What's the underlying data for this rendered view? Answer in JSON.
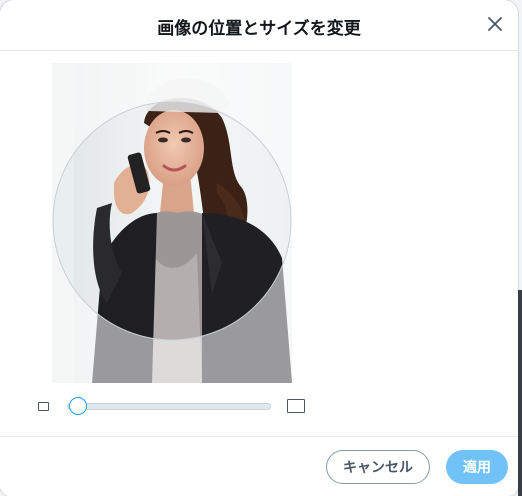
{
  "dialog": {
    "title": "画像の位置とサイズを変更",
    "close_icon": "close-icon"
  },
  "editor": {
    "image_description": "photo",
    "crop_shape": "circle",
    "zoom_level": 0.05,
    "zoom_min_icon": "small-square-icon",
    "zoom_max_icon": "large-square-icon"
  },
  "footer": {
    "cancel_label": "キャンセル",
    "apply_label": "適用"
  },
  "colors": {
    "accent": "#1da1f2",
    "apply_button": "#71c2f6",
    "title_text": "#14171a"
  }
}
